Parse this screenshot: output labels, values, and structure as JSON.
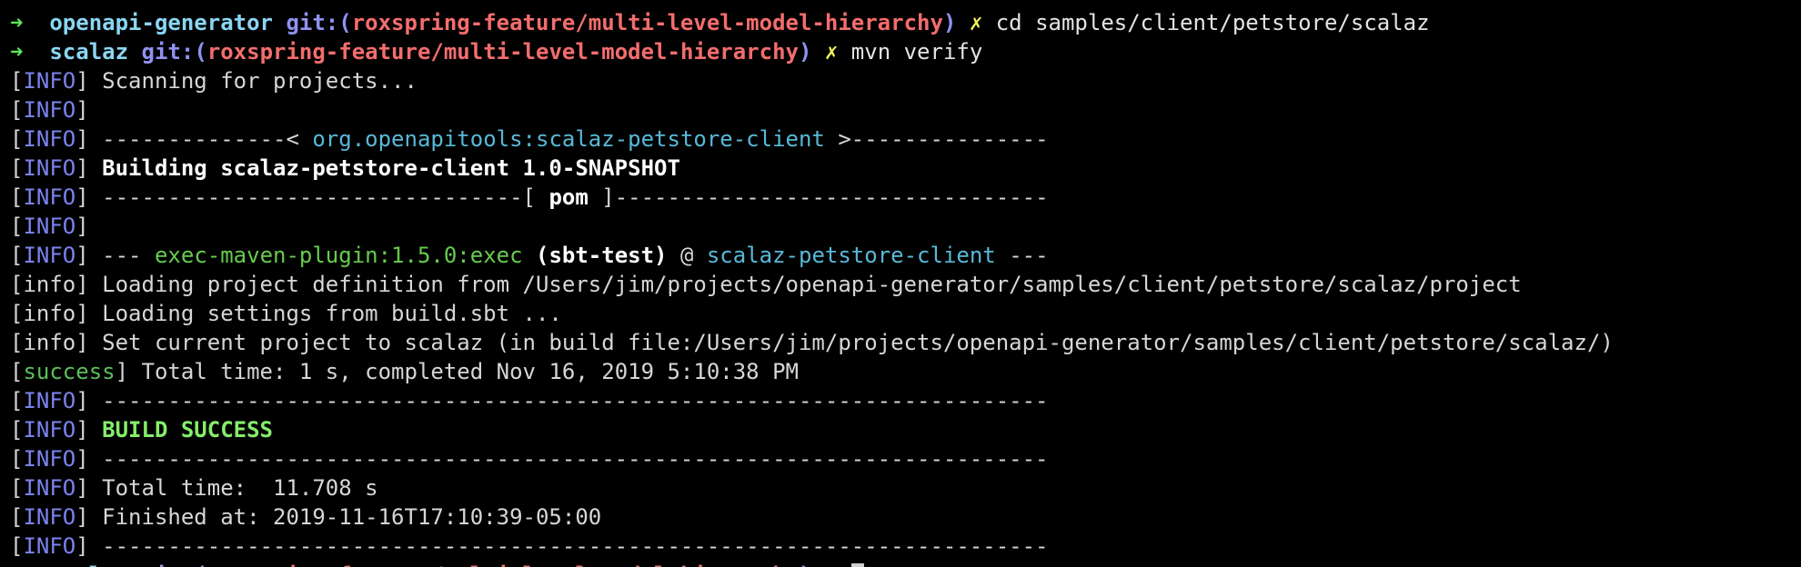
{
  "prompts": [
    {
      "arrow": "➜",
      "directory": "openapi-generator",
      "git_prefix": "git:(",
      "branch": "roxspring-feature/multi-level-model-hierarchy",
      "git_suffix": ")",
      "dirty_marker": "✗",
      "command": "cd samples/client/petstore/scalaz"
    },
    {
      "arrow": "➜",
      "directory": "scalaz",
      "git_prefix": "git:(",
      "branch": "roxspring-feature/multi-level-model-hierarchy",
      "git_suffix": ")",
      "dirty_marker": "✗",
      "command": "mvn verify"
    }
  ],
  "output": {
    "info_tag": "INFO",
    "lower_info_tag": "info",
    "success_tag": "success",
    "scanning": "Scanning for projects...",
    "header_left_dashes": "--------------<",
    "artifact_id": "org.openapitools:scalaz-petstore-client",
    "header_right_dashes": ">---------------",
    "building": "Building scalaz-petstore-client 1.0-SNAPSHOT",
    "packaging_left": "--------------------------------[",
    "packaging": "pom",
    "packaging_right": "]---------------------------------",
    "plugin_prefix": "---",
    "plugin": "exec-maven-plugin:1.5.0:exec",
    "execution": "(sbt-test)",
    "at_sign": "@",
    "plugin_project": "scalaz-petstore-client",
    "plugin_suffix": "---",
    "sbt_loading_project": "Loading project definition from /Users/jim/projects/openapi-generator/samples/client/petstore/scalaz/project",
    "sbt_loading_settings": "Loading settings from build.sbt ...",
    "sbt_set_project": "Set current project to scalaz (in build file:/Users/jim/projects/openapi-generator/samples/client/petstore/scalaz/)",
    "sbt_total_time": "Total time: 1 s, completed Nov 16, 2019 5:10:38 PM",
    "separator": "------------------------------------------------------------------------",
    "build_result": "BUILD SUCCESS",
    "total_time": "Total time:  11.708 s",
    "finished_at": "Finished at: 2019-11-16T17:10:39-05:00"
  },
  "colors": {
    "background": "#000000",
    "arrow": "#5fe35b",
    "directory": "#8ad6f2",
    "git_label": "#9092f0",
    "branch": "#f36d6d",
    "dirty_marker": "#f2f259",
    "log_tag": "#7b83ee",
    "artifact": "#59b8d8",
    "plugin": "#66cc4e",
    "build_success": "#85ee6a"
  }
}
